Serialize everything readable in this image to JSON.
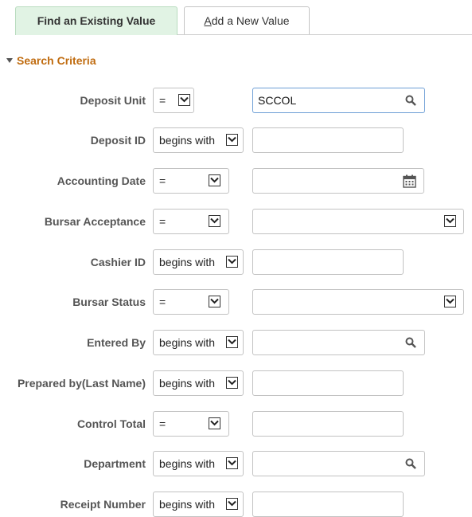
{
  "tabs": {
    "find_existing": "Find an Existing Value",
    "add_new_prefix": "A",
    "add_new_rest": "dd a New Value"
  },
  "section": {
    "title": "Search Criteria"
  },
  "fields": [
    {
      "label": "Deposit Unit",
      "operator": "=",
      "value": "SCCOL",
      "icon": "search-icon"
    },
    {
      "label": "Deposit ID",
      "operator": "begins with",
      "value": ""
    },
    {
      "label": "Accounting Date",
      "operator": "=",
      "value": "",
      "icon": "calendar-icon"
    },
    {
      "label": "Bursar Acceptance",
      "operator": "=",
      "value": ""
    },
    {
      "label": "Cashier ID",
      "operator": "begins with",
      "value": ""
    },
    {
      "label": "Bursar Status",
      "operator": "=",
      "value": ""
    },
    {
      "label": "Entered By",
      "operator": "begins with",
      "value": "",
      "icon": "search-icon"
    },
    {
      "label": "Prepared by(Last Name)",
      "operator": "begins with",
      "value": ""
    },
    {
      "label": "Control Total",
      "operator": "=",
      "value": ""
    },
    {
      "label": "Department",
      "operator": "begins with",
      "value": "",
      "icon": "search-icon"
    },
    {
      "label": "Receipt Number",
      "operator": "begins with",
      "value": ""
    }
  ],
  "colors": {
    "section_title": "#c06c10",
    "active_tab_bg": "#e1f3e4",
    "focus_border": "#6d9ed6"
  }
}
